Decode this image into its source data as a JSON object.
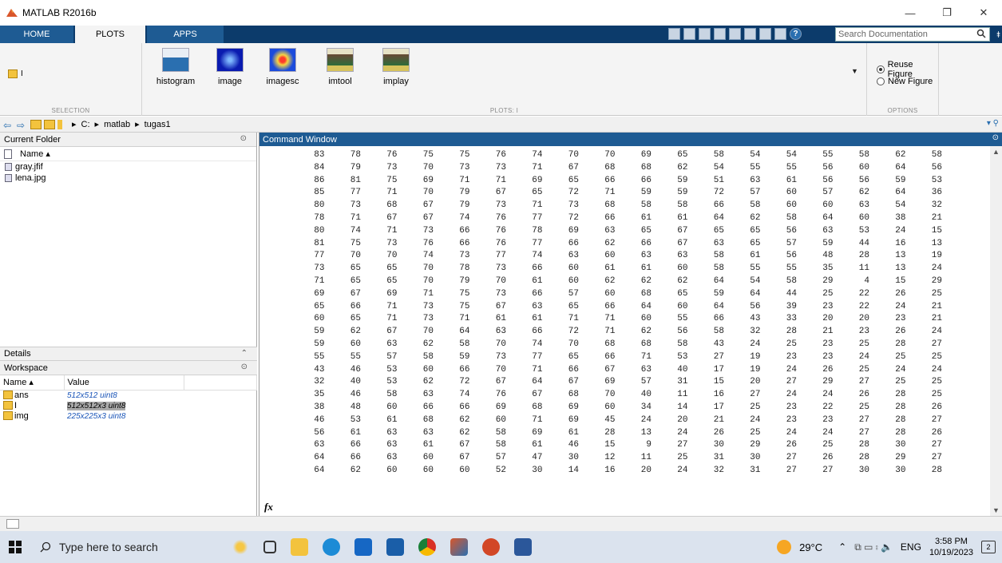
{
  "window": {
    "title": "MATLAB R2016b",
    "controls": [
      "—",
      "❐",
      "✕"
    ]
  },
  "tabs": [
    {
      "label": "HOME"
    },
    {
      "label": "PLOTS"
    },
    {
      "label": "APPS"
    }
  ],
  "search": {
    "placeholder": "Search Documentation"
  },
  "ribbon": {
    "selection_label": "SELECTION",
    "selection_var": "I",
    "plots_label": "PLOTS: I",
    "options_label": "OPTIONS",
    "gallery": [
      {
        "label": "histogram"
      },
      {
        "label": "image"
      },
      {
        "label": "imagesc"
      },
      {
        "label": "imtool"
      },
      {
        "label": "implay"
      }
    ],
    "options": [
      {
        "label": "Reuse Figure",
        "selected": true
      },
      {
        "label": "New Figure",
        "selected": false
      }
    ]
  },
  "path": {
    "crumbs": [
      "C:",
      "matlab",
      "tugas1"
    ]
  },
  "current_folder": {
    "title": "Current Folder",
    "col_name": "Name ▴",
    "files": [
      "gray.jfif",
      "lena.jpg"
    ]
  },
  "details": {
    "title": "Details"
  },
  "workspace": {
    "title": "Workspace",
    "col_name": "Name ▴",
    "col_value": "Value",
    "vars": [
      {
        "name": "ans",
        "value": "512x512 uint8"
      },
      {
        "name": "I",
        "value": "512x512x3 uint8"
      },
      {
        "name": "img",
        "value": "225x225x3 uint8"
      }
    ]
  },
  "command_window": {
    "title": "Command Window",
    "prompt": "fx",
    "rows": [
      [
        83,
        78,
        76,
        75,
        75,
        76,
        74,
        70,
        70,
        69,
        65,
        58,
        54,
        54,
        55,
        58,
        62,
        58
      ],
      [
        84,
        79,
        73,
        70,
        73,
        73,
        71,
        67,
        68,
        68,
        62,
        54,
        55,
        55,
        56,
        60,
        64,
        56
      ],
      [
        86,
        81,
        75,
        69,
        71,
        71,
        69,
        65,
        66,
        66,
        59,
        51,
        63,
        61,
        56,
        56,
        59,
        53
      ],
      [
        85,
        77,
        71,
        70,
        79,
        67,
        65,
        72,
        71,
        59,
        59,
        72,
        57,
        60,
        57,
        62,
        64,
        36
      ],
      [
        80,
        73,
        68,
        67,
        79,
        73,
        71,
        73,
        68,
        58,
        58,
        66,
        58,
        60,
        60,
        63,
        54,
        32
      ],
      [
        78,
        71,
        67,
        67,
        74,
        76,
        77,
        72,
        66,
        61,
        61,
        64,
        62,
        58,
        64,
        60,
        38,
        21
      ],
      [
        80,
        74,
        71,
        73,
        66,
        76,
        78,
        69,
        63,
        65,
        67,
        65,
        65,
        56,
        63,
        53,
        24,
        15
      ],
      [
        81,
        75,
        73,
        76,
        66,
        76,
        77,
        66,
        62,
        66,
        67,
        63,
        65,
        57,
        59,
        44,
        16,
        13
      ],
      [
        77,
        70,
        70,
        74,
        73,
        77,
        74,
        63,
        60,
        63,
        63,
        58,
        61,
        56,
        48,
        28,
        13,
        19
      ],
      [
        73,
        65,
        65,
        70,
        78,
        73,
        66,
        60,
        61,
        61,
        60,
        58,
        55,
        55,
        35,
        11,
        13,
        24
      ],
      [
        71,
        65,
        65,
        70,
        79,
        70,
        61,
        60,
        62,
        62,
        62,
        64,
        54,
        58,
        29,
        4,
        15,
        29
      ],
      [
        69,
        67,
        69,
        71,
        75,
        73,
        66,
        57,
        60,
        68,
        65,
        59,
        64,
        44,
        25,
        22,
        26,
        25
      ],
      [
        65,
        66,
        71,
        73,
        75,
        67,
        63,
        65,
        66,
        64,
        60,
        64,
        56,
        39,
        23,
        22,
        24,
        21
      ],
      [
        60,
        65,
        71,
        73,
        71,
        61,
        61,
        71,
        71,
        60,
        55,
        66,
        43,
        33,
        20,
        20,
        23,
        21
      ],
      [
        59,
        62,
        67,
        70,
        64,
        63,
        66,
        72,
        71,
        62,
        56,
        58,
        32,
        28,
        21,
        23,
        26,
        24
      ],
      [
        59,
        60,
        63,
        62,
        58,
        70,
        74,
        70,
        68,
        68,
        58,
        43,
        24,
        25,
        23,
        25,
        28,
        27
      ],
      [
        55,
        55,
        57,
        58,
        59,
        73,
        77,
        65,
        66,
        71,
        53,
        27,
        19,
        23,
        23,
        24,
        25,
        25
      ],
      [
        43,
        46,
        53,
        60,
        66,
        70,
        71,
        66,
        67,
        63,
        40,
        17,
        19,
        24,
        26,
        25,
        24,
        24
      ],
      [
        32,
        40,
        53,
        62,
        72,
        67,
        64,
        67,
        69,
        57,
        31,
        15,
        20,
        27,
        29,
        27,
        25,
        25
      ],
      [
        35,
        46,
        58,
        63,
        74,
        76,
        67,
        68,
        70,
        40,
        11,
        16,
        27,
        24,
        24,
        26,
        28,
        25
      ],
      [
        38,
        48,
        60,
        66,
        66,
        69,
        68,
        69,
        60,
        34,
        14,
        17,
        25,
        23,
        22,
        25,
        28,
        26
      ],
      [
        46,
        53,
        61,
        68,
        62,
        60,
        71,
        69,
        45,
        24,
        20,
        21,
        24,
        23,
        23,
        27,
        28,
        27
      ],
      [
        56,
        61,
        63,
        63,
        62,
        58,
        69,
        61,
        28,
        13,
        24,
        26,
        25,
        24,
        24,
        27,
        28,
        26
      ],
      [
        63,
        66,
        63,
        61,
        67,
        58,
        61,
        46,
        15,
        9,
        27,
        30,
        29,
        26,
        25,
        28,
        30,
        27
      ],
      [
        64,
        66,
        63,
        60,
        67,
        57,
        47,
        30,
        12,
        11,
        25,
        31,
        30,
        27,
        26,
        28,
        29,
        27
      ],
      [
        64,
        62,
        60,
        60,
        60,
        52,
        30,
        14,
        16,
        20,
        24,
        32,
        31,
        27,
        27,
        30,
        30,
        28
      ]
    ]
  },
  "taskbar": {
    "search_placeholder": "Type here to search",
    "temp": "29°C",
    "lang": "ENG",
    "time": "3:58 PM",
    "date": "10/19/2023",
    "notif": "2"
  }
}
